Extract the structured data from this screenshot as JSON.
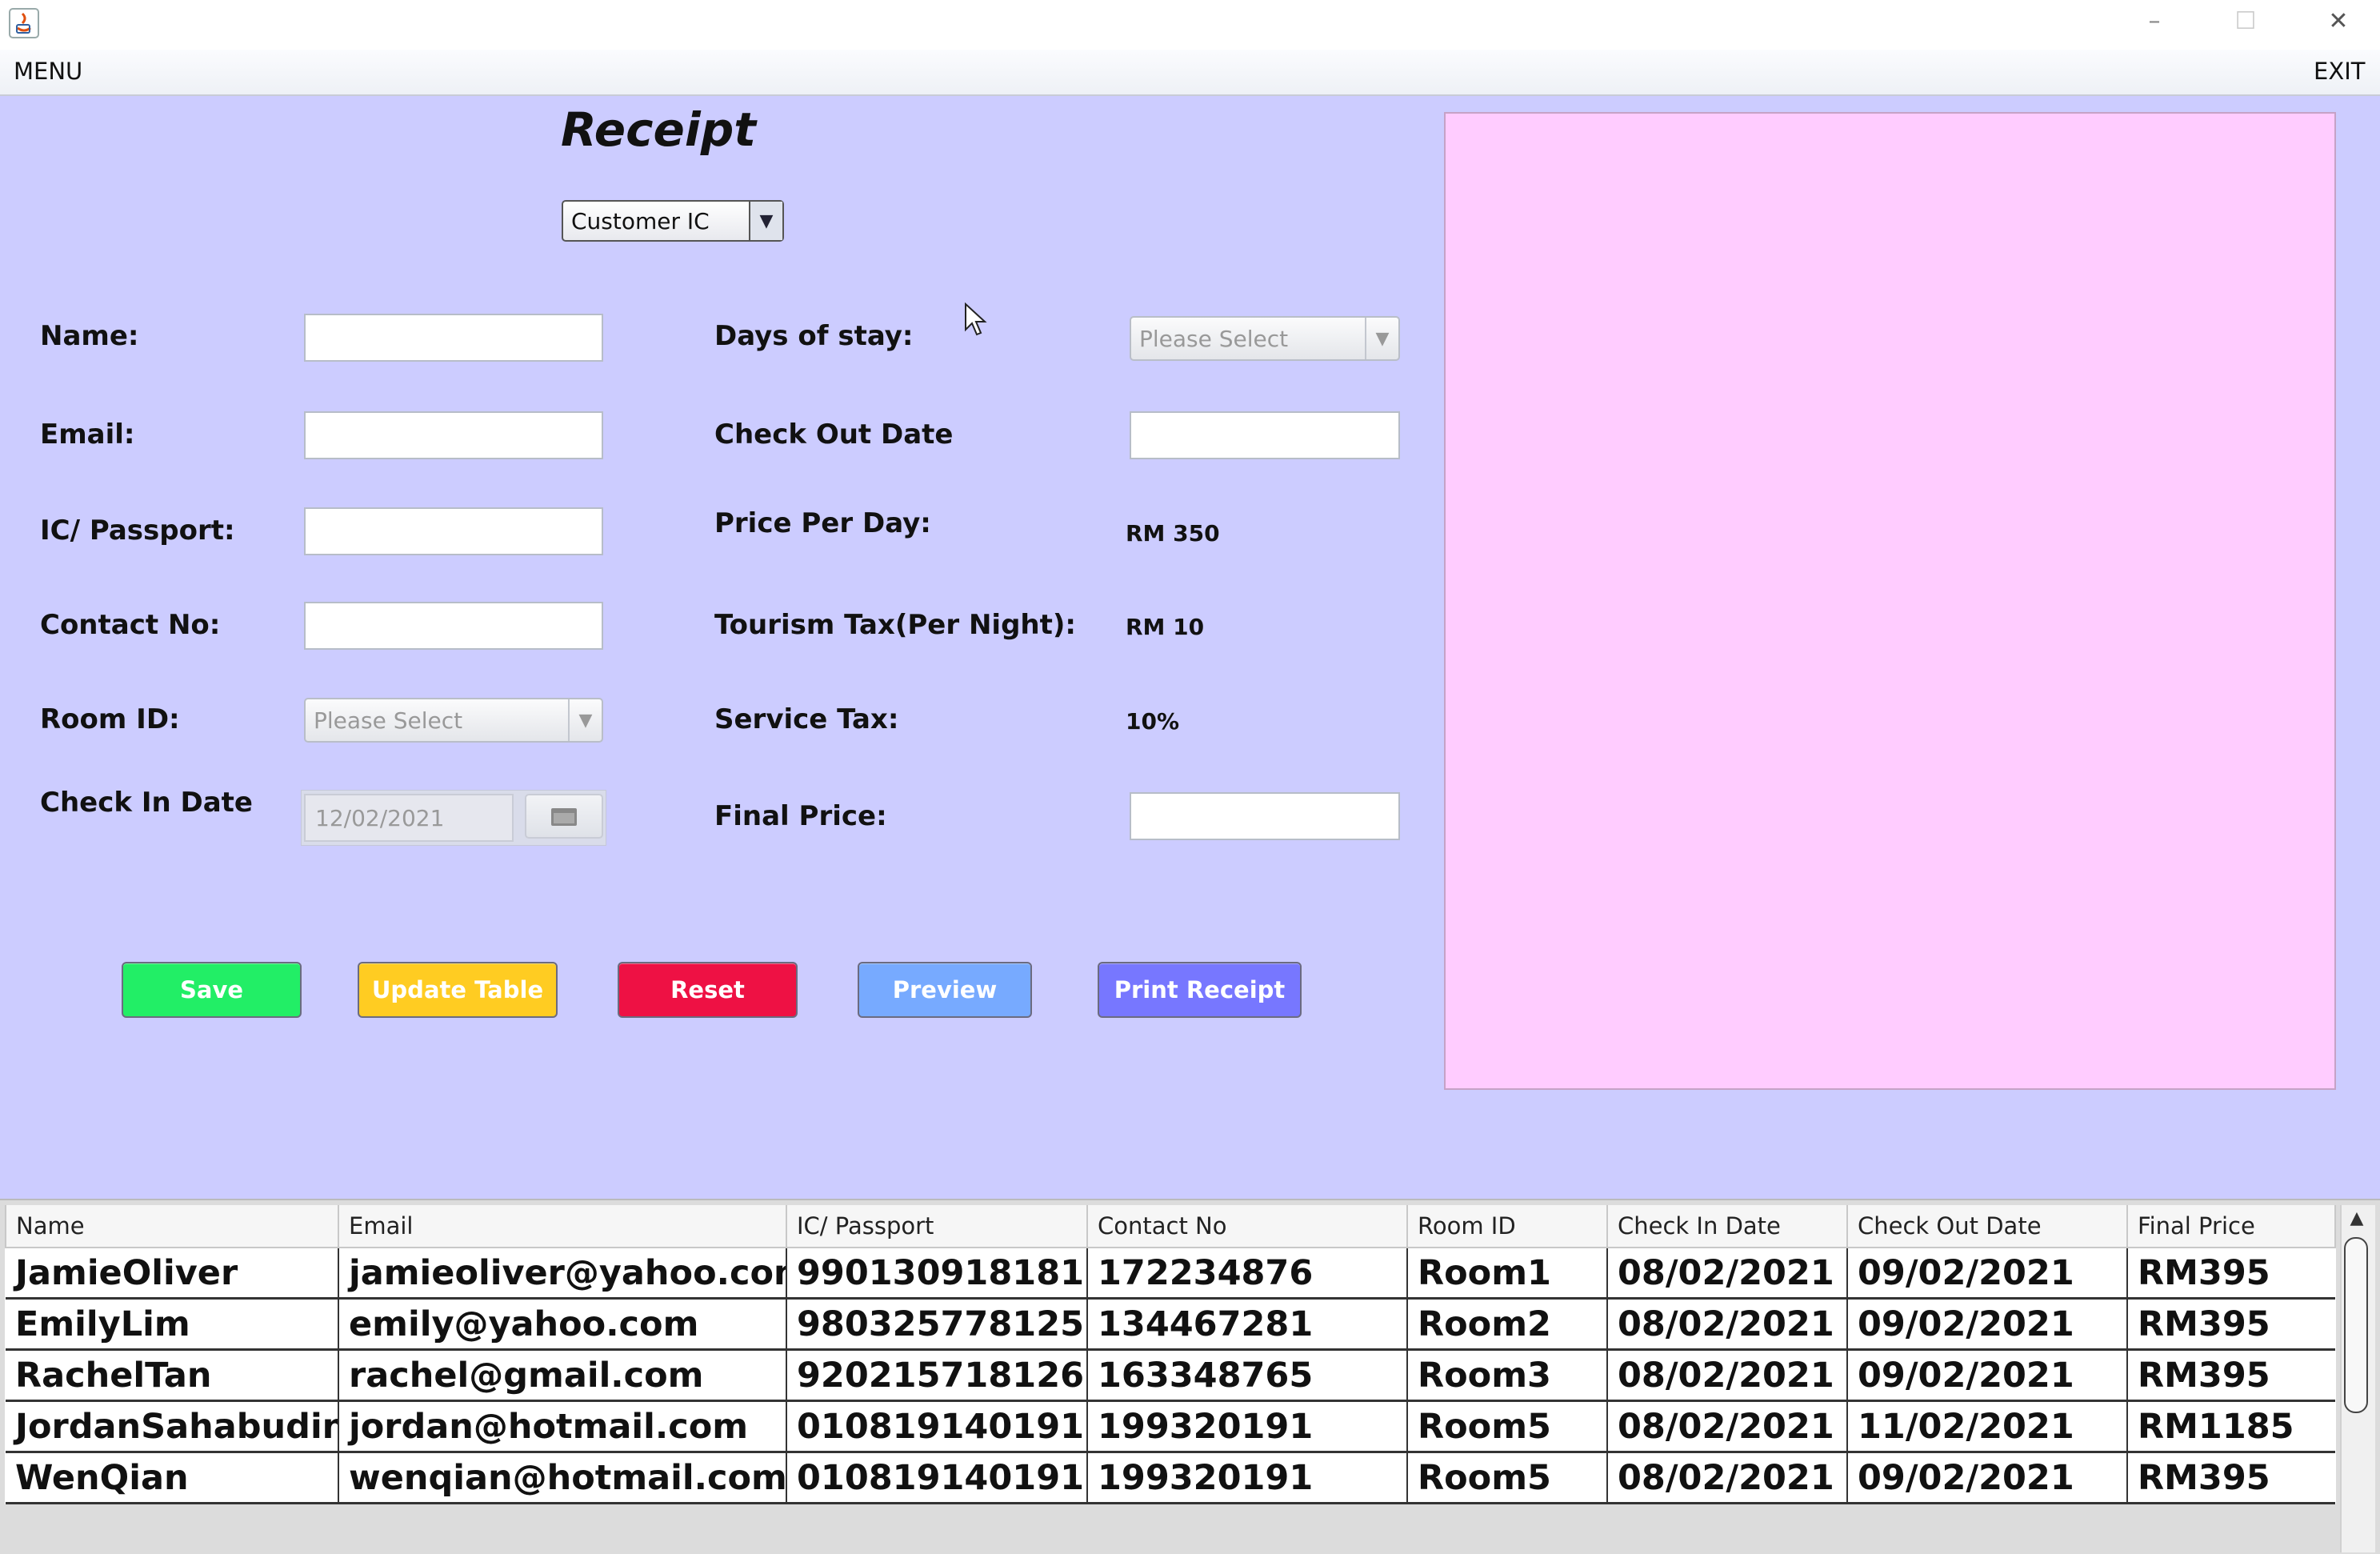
{
  "window": {
    "minimize": "–",
    "maximize": "☐",
    "close": "✕"
  },
  "menu": {
    "left": "MENU",
    "right": "EXIT"
  },
  "form": {
    "title": "Receipt",
    "customer_combo": "Customer IC",
    "labels": {
      "name": "Name:",
      "email": "Email:",
      "ic": "IC/ Passport:",
      "contact": "Contact No:",
      "room": "Room ID:",
      "checkin": "Check In Date",
      "days": "Days of stay:",
      "checkout": "Check Out Date",
      "price_per_day": "Price Per Day:",
      "tourism_tax": "Tourism Tax(Per Night):",
      "service_tax": "Service Tax:",
      "final_price": "Final Price:"
    },
    "values": {
      "price_per_day": "RM 350",
      "tourism_tax": "RM 10",
      "service_tax": "10%",
      "checkin_date": "12/02/2021"
    },
    "room_placeholder": "Please Select",
    "days_placeholder": "Please Select",
    "name_value": "",
    "email_value": "",
    "ic_value": "",
    "contact_value": "",
    "checkout_value": "",
    "final_value": ""
  },
  "buttons": {
    "save": "Save",
    "update": "Update Table",
    "reset": "Reset",
    "preview": "Preview",
    "print": "Print Receipt"
  },
  "colors": {
    "background": "#ccccff",
    "preview_panel": "#ffccff",
    "save": "#22ee66",
    "update": "#ffcc22",
    "reset": "#ee1144",
    "preview": "#77aaff",
    "print": "#7777ff"
  },
  "table": {
    "headers": [
      "Name",
      "Email",
      "IC/ Passport",
      "Contact No",
      "Room ID",
      "Check In Date",
      "Check Out Date",
      "Final Price"
    ],
    "rows": [
      [
        "JamieOliver",
        "jamieoliver@yahoo.com",
        "990130918181",
        "172234876",
        "Room1",
        "08/02/2021",
        "09/02/2021",
        "RM395"
      ],
      [
        "EmilyLim",
        "emily@yahoo.com",
        "980325778125",
        "134467281",
        "Room2",
        "08/02/2021",
        "09/02/2021",
        "RM395"
      ],
      [
        "RachelTan",
        "rachel@gmail.com",
        "920215718126",
        "163348765",
        "Room3",
        "08/02/2021",
        "09/02/2021",
        "RM395"
      ],
      [
        "JordanSahabudin",
        "jordan@hotmail.com",
        "010819140191",
        "199320191",
        "Room5",
        "08/02/2021",
        "11/02/2021",
        "RM1185"
      ],
      [
        "WenQian",
        "wenqian@hotmail.com",
        "010819140191",
        "199320191",
        "Room5",
        "08/02/2021",
        "09/02/2021",
        "RM395"
      ]
    ]
  }
}
